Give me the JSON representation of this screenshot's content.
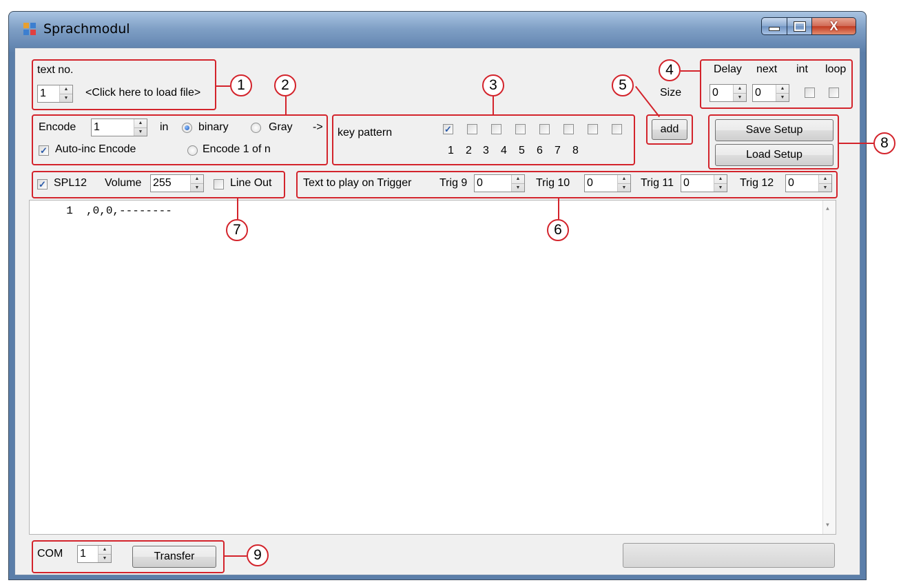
{
  "window": {
    "title": "Sprachmodul",
    "close_label": "X"
  },
  "group1": {
    "label": "text no.",
    "text_no_value": "1",
    "load_file_label": "<Click here to load file>"
  },
  "group2": {
    "encode_label": "Encode",
    "encode_value": "1",
    "in_label": "in",
    "binary_label": "binary",
    "gray_label": "Gray",
    "arrow_label": "->",
    "autoinc_label": "Auto-inc Encode",
    "encode1ofn_label": "Encode 1 of n",
    "binary_checked": true,
    "autoinc_checked": true
  },
  "group3": {
    "key_pattern_label": "key pattern",
    "keys": [
      {
        "num": "1",
        "checked": true
      },
      {
        "num": "2",
        "checked": false
      },
      {
        "num": "3",
        "checked": false
      },
      {
        "num": "4",
        "checked": false
      },
      {
        "num": "5",
        "checked": false
      },
      {
        "num": "6",
        "checked": false
      },
      {
        "num": "7",
        "checked": false
      },
      {
        "num": "8",
        "checked": false
      }
    ]
  },
  "group4": {
    "delay_label": "Delay",
    "next_label": "next",
    "int_label": "int",
    "loop_label": "loop",
    "size_label": "Size",
    "delay_value": "0",
    "next_value": "0"
  },
  "group5": {
    "add_label": "add"
  },
  "group6": {
    "trigger_label": "Text to play on Trigger",
    "trig9_label": "Trig 9",
    "trig9_value": "0",
    "trig10_label": "Trig 10",
    "trig10_value": "0",
    "trig11_label": "Trig 11",
    "trig11_value": "0",
    "trig12_label": "Trig 12",
    "trig12_value": "0"
  },
  "group7": {
    "spl12_label": "SPL12",
    "volume_label": "Volume",
    "volume_value": "255",
    "lineout_label": "Line Out",
    "spl12_checked": true
  },
  "group8": {
    "save_label": "Save Setup",
    "load_label": "Load Setup"
  },
  "group9": {
    "com_label": "COM",
    "com_value": "1",
    "transfer_label": "Transfer"
  },
  "editor": {
    "line1": "  1  ,0,0,--------"
  },
  "callouts": {
    "c1": "1",
    "c2": "2",
    "c3": "3",
    "c4": "4",
    "c5": "5",
    "c6": "6",
    "c7": "7",
    "c8": "8",
    "c9": "9"
  },
  "colors": {
    "callout_red": "#d3232b",
    "client_bg": "#f0f0f0"
  }
}
